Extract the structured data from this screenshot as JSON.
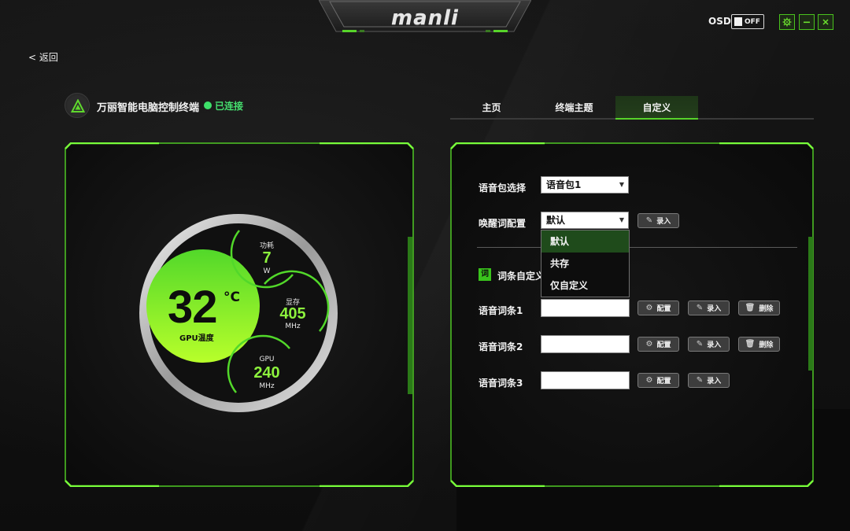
{
  "titlebar": {
    "brand": "manli",
    "osd_label": "OSD",
    "osd_state": "OFF",
    "accent": "#57d42a"
  },
  "nav": {
    "back_label": "< 返回"
  },
  "app": {
    "name": "万丽智能电脑控制终端",
    "status": "已连接",
    "status_color": "#46e06f"
  },
  "tabs": [
    {
      "label": "主页",
      "active": false
    },
    {
      "label": "终端主题",
      "active": false
    },
    {
      "label": "自定义",
      "active": true
    }
  ],
  "gauge": {
    "temperature": "32",
    "temperature_unit": "°C",
    "temperature_label": "GPU温度",
    "power": {
      "title": "功耗",
      "value": "7",
      "unit": "W"
    },
    "memory": {
      "title": "显存",
      "value": "405",
      "unit": "MHz"
    },
    "gpu": {
      "title": "GPU",
      "value": "240",
      "unit": "MHz"
    }
  },
  "form": {
    "voice_pack": {
      "label": "语音包选择",
      "value": "语音包1"
    },
    "wake_word": {
      "label": "唤醒词配置",
      "value": "默认",
      "record_label": "录入",
      "options": [
        "默认",
        "共存",
        "仅自定义"
      ],
      "selected_option": "默认"
    },
    "custom_section": {
      "badge": "词",
      "title": "词条自定义"
    },
    "entries": [
      {
        "label": "语音词条1",
        "value": "",
        "config_label": "配置",
        "record_label": "录入",
        "delete_label": "删除"
      },
      {
        "label": "语音词条2",
        "value": "",
        "config_label": "配置",
        "record_label": "录入",
        "delete_label": "删除"
      },
      {
        "label": "语音词条3",
        "value": "",
        "config_label": "配置",
        "record_label": "录入"
      }
    ]
  }
}
